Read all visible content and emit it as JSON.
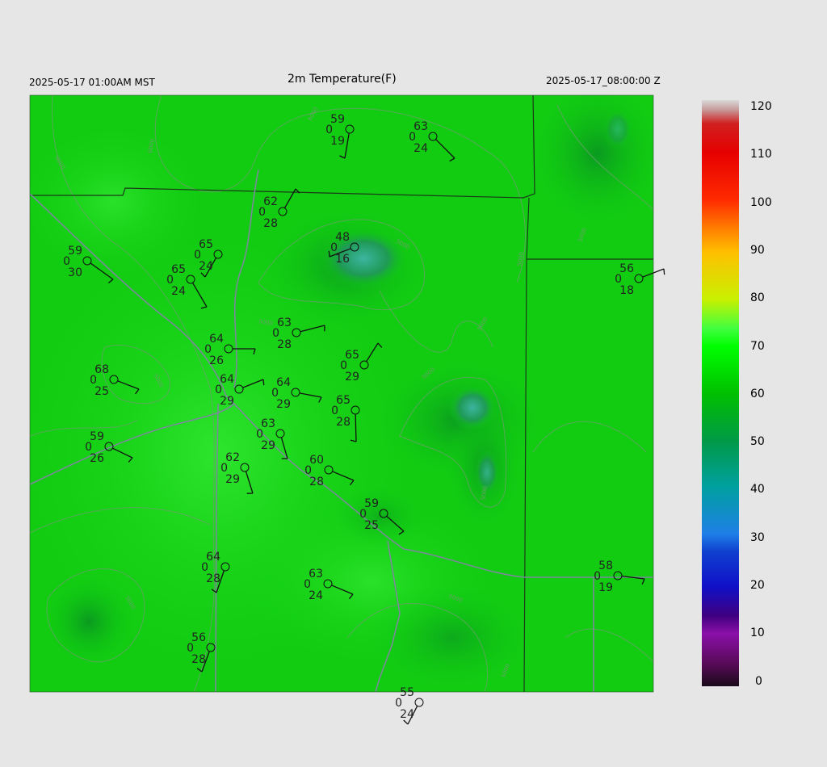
{
  "header": {
    "local_time": "2025-05-17 01:00AM MST",
    "title": "2m Temperature(F)",
    "utc_time": "2025-05-17_08:00:00 Z"
  },
  "colorbar": {
    "ticks": [
      "120",
      "110",
      "100",
      "90",
      "80",
      "70",
      "60",
      "50",
      "40",
      "30",
      "20",
      "10",
      "0"
    ],
    "range": [
      0,
      120
    ],
    "colors": {
      "top": "#d9d9d9",
      "t110": "#e60000",
      "t100": "#ff2a00",
      "t90": "#ffc000",
      "t80": "#c8f000",
      "t70": "#00ff00",
      "t60": "#00c000",
      "t50": "#009a45",
      "t40": "#00a0a0",
      "t30": "#1e7fe6",
      "t20": "#1010c8",
      "t10": "#8a10a8",
      "bottom": "#1a0a1a"
    }
  },
  "field": {
    "base_color": "#10d010",
    "cool_color": "#40b8a0",
    "warm_color": "#30e830"
  },
  "stations": [
    {
      "temp": "59",
      "dew": "19",
      "cloud": "0"
    },
    {
      "temp": "63",
      "dew": "24",
      "cloud": "0"
    },
    {
      "temp": "62",
      "dew": "28",
      "cloud": "0"
    },
    {
      "temp": "48",
      "dew": "16",
      "cloud": "0"
    },
    {
      "temp": "59",
      "dew": "30",
      "cloud": "0"
    },
    {
      "temp": "65",
      "dew": "24",
      "cloud": "0"
    },
    {
      "temp": "65",
      "dew": "24",
      "cloud": "0"
    },
    {
      "temp": "56",
      "dew": "18",
      "cloud": "0"
    },
    {
      "temp": "63",
      "dew": "28",
      "cloud": "0"
    },
    {
      "temp": "64",
      "dew": "26",
      "cloud": "0"
    },
    {
      "temp": "65",
      "dew": "29",
      "cloud": "0"
    },
    {
      "temp": "68",
      "dew": "25",
      "cloud": "0"
    },
    {
      "temp": "64",
      "dew": "29",
      "cloud": "0"
    },
    {
      "temp": "64",
      "dew": "29",
      "cloud": "0"
    },
    {
      "temp": "65",
      "dew": "28",
      "cloud": "0"
    },
    {
      "temp": "63",
      "dew": "29",
      "cloud": "0"
    },
    {
      "temp": "59",
      "dew": "26",
      "cloud": "0"
    },
    {
      "temp": "62",
      "dew": "29",
      "cloud": "0"
    },
    {
      "temp": "60",
      "dew": "28",
      "cloud": "0"
    },
    {
      "temp": "59",
      "dew": "25",
      "cloud": "0"
    },
    {
      "temp": "64",
      "dew": "28",
      "cloud": "0"
    },
    {
      "temp": "58",
      "dew": "19",
      "cloud": "0"
    },
    {
      "temp": "63",
      "dew": "24",
      "cloud": "0"
    },
    {
      "temp": "56",
      "dew": "28",
      "cloud": "0"
    },
    {
      "temp": "55",
      "dew": "24",
      "cloud": "0"
    }
  ]
}
